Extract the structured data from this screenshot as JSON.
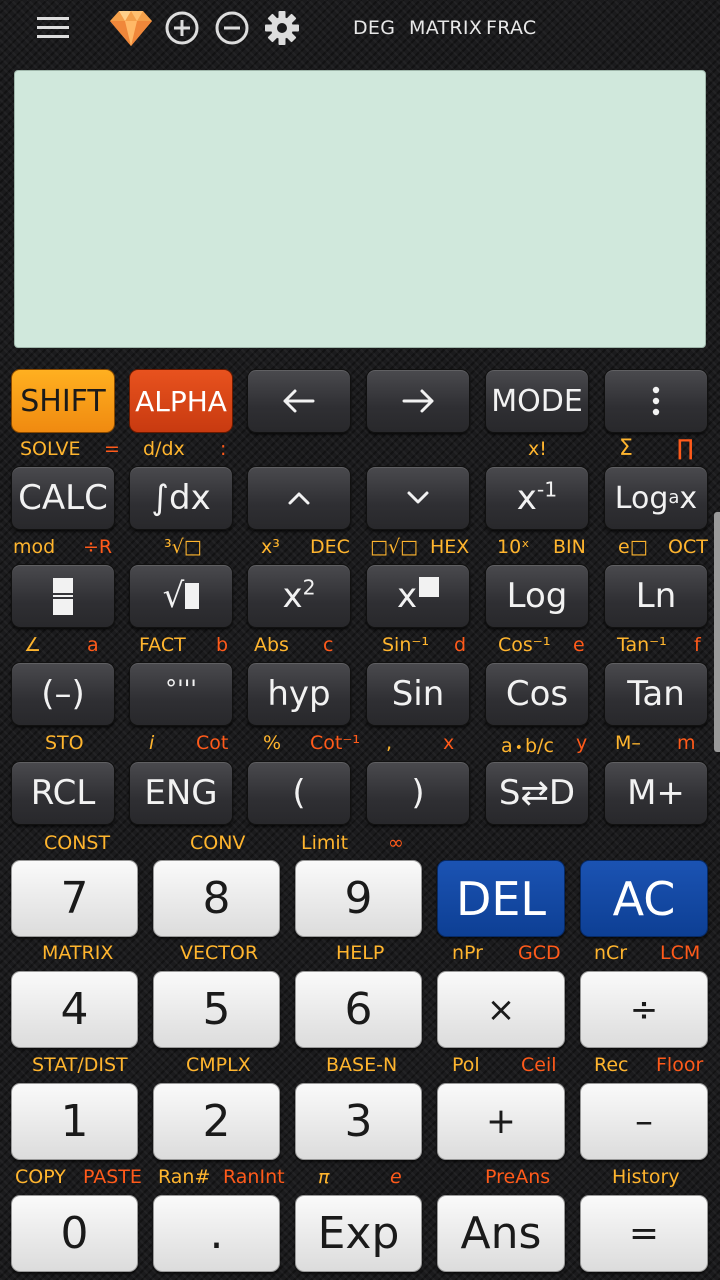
{
  "status": {
    "angle": "DEG",
    "mode1": "MATRIX",
    "mode2": "FRAC"
  },
  "icons": [
    "menu-icon",
    "diamond-icon",
    "zoom-in-icon",
    "zoom-out-icon",
    "gear-icon"
  ],
  "colors": {
    "shift": "#f08a10",
    "alpha": "#d4441a",
    "del_ac": "#0d3f94",
    "display": "#d0e8dc",
    "label_yellow": "#ffb52e",
    "label_red": "#ff5a1a"
  },
  "keys": {
    "shift": "SHIFT",
    "alpha": "ALPHA",
    "left": "←",
    "right": "→",
    "mode": "MODE",
    "more": "⋮",
    "calc": "CALC",
    "integral": "∫dx",
    "up": "⌃",
    "down": "⌄",
    "log_base_pre": "Log",
    "log_base_sub": "a",
    "log_base_post": "x",
    "sqrt": "√",
    "log": "Log",
    "ln": "Ln",
    "neg": "(–)",
    "deg": "°'''",
    "hyp": "hyp",
    "sin": "Sin",
    "cos": "Cos",
    "tan": "Tan",
    "rcl": "RCL",
    "eng": "ENG",
    "lparen": "(",
    "rparen": ")",
    "sd": "S⇄D",
    "mplus": "M+",
    "n7": "7",
    "n8": "8",
    "n9": "9",
    "del": "DEL",
    "ac": "AC",
    "n4": "4",
    "n5": "5",
    "n6": "6",
    "mul": "×",
    "div": "÷",
    "n1": "1",
    "n2": "2",
    "n3": "3",
    "add": "+",
    "sub": "–",
    "n0": "0",
    "dot": ".",
    "exp": "Exp",
    "ans": "Ans",
    "eq": "="
  },
  "labels": {
    "solve": "SOLVE",
    "eq_small": "=",
    "ddx": "d/dx",
    "colon": ":",
    "fact_x": "x!",
    "sigma": "Σ",
    "pi_prod": "∏",
    "mod": "mod",
    "divr": "÷R",
    "cbrt": "³√□",
    "x3": "x³",
    "dec": "DEC",
    "nroot": "□√□",
    "hex": "HEX",
    "ten_x": "10ˣ",
    "bin": "BIN",
    "e_box": "e□",
    "oct": "OCT",
    "angle": "∠",
    "a": "a",
    "fact": "FACT",
    "b": "b",
    "abs": "Abs",
    "c": "c",
    "sin_inv": "Sin⁻¹",
    "d": "d",
    "cos_inv": "Cos⁻¹",
    "e": "e",
    "tan_inv": "Tan⁻¹",
    "f": "f",
    "sto": "STO",
    "i": "i",
    "cot": "Cot",
    "percent": "%",
    "cot_inv": "Cot⁻¹",
    "comma": ",",
    "x": "x",
    "abc": "a᭼b/c",
    "y": "y",
    "mminus": "M–",
    "m": "m",
    "const": "CONST",
    "conv": "CONV",
    "limit": "Limit",
    "inf": "∞",
    "matrix": "MATRIX",
    "vector": "VECTOR",
    "help": "HELP",
    "npr": "nPr",
    "gcd": "GCD",
    "ncr": "nCr",
    "lcm": "LCM",
    "statdist": "STAT/DIST",
    "cmplx": "CMPLX",
    "basen": "BASE-N",
    "pol": "Pol",
    "ceil": "Ceil",
    "rec": "Rec",
    "floor": "Floor",
    "copy": "COPY",
    "paste": "PASTE",
    "ran": "Ran#",
    "ranint": "RanInt",
    "pi": "π",
    "e_const": "e",
    "preans": "PreAns",
    "history": "History"
  }
}
